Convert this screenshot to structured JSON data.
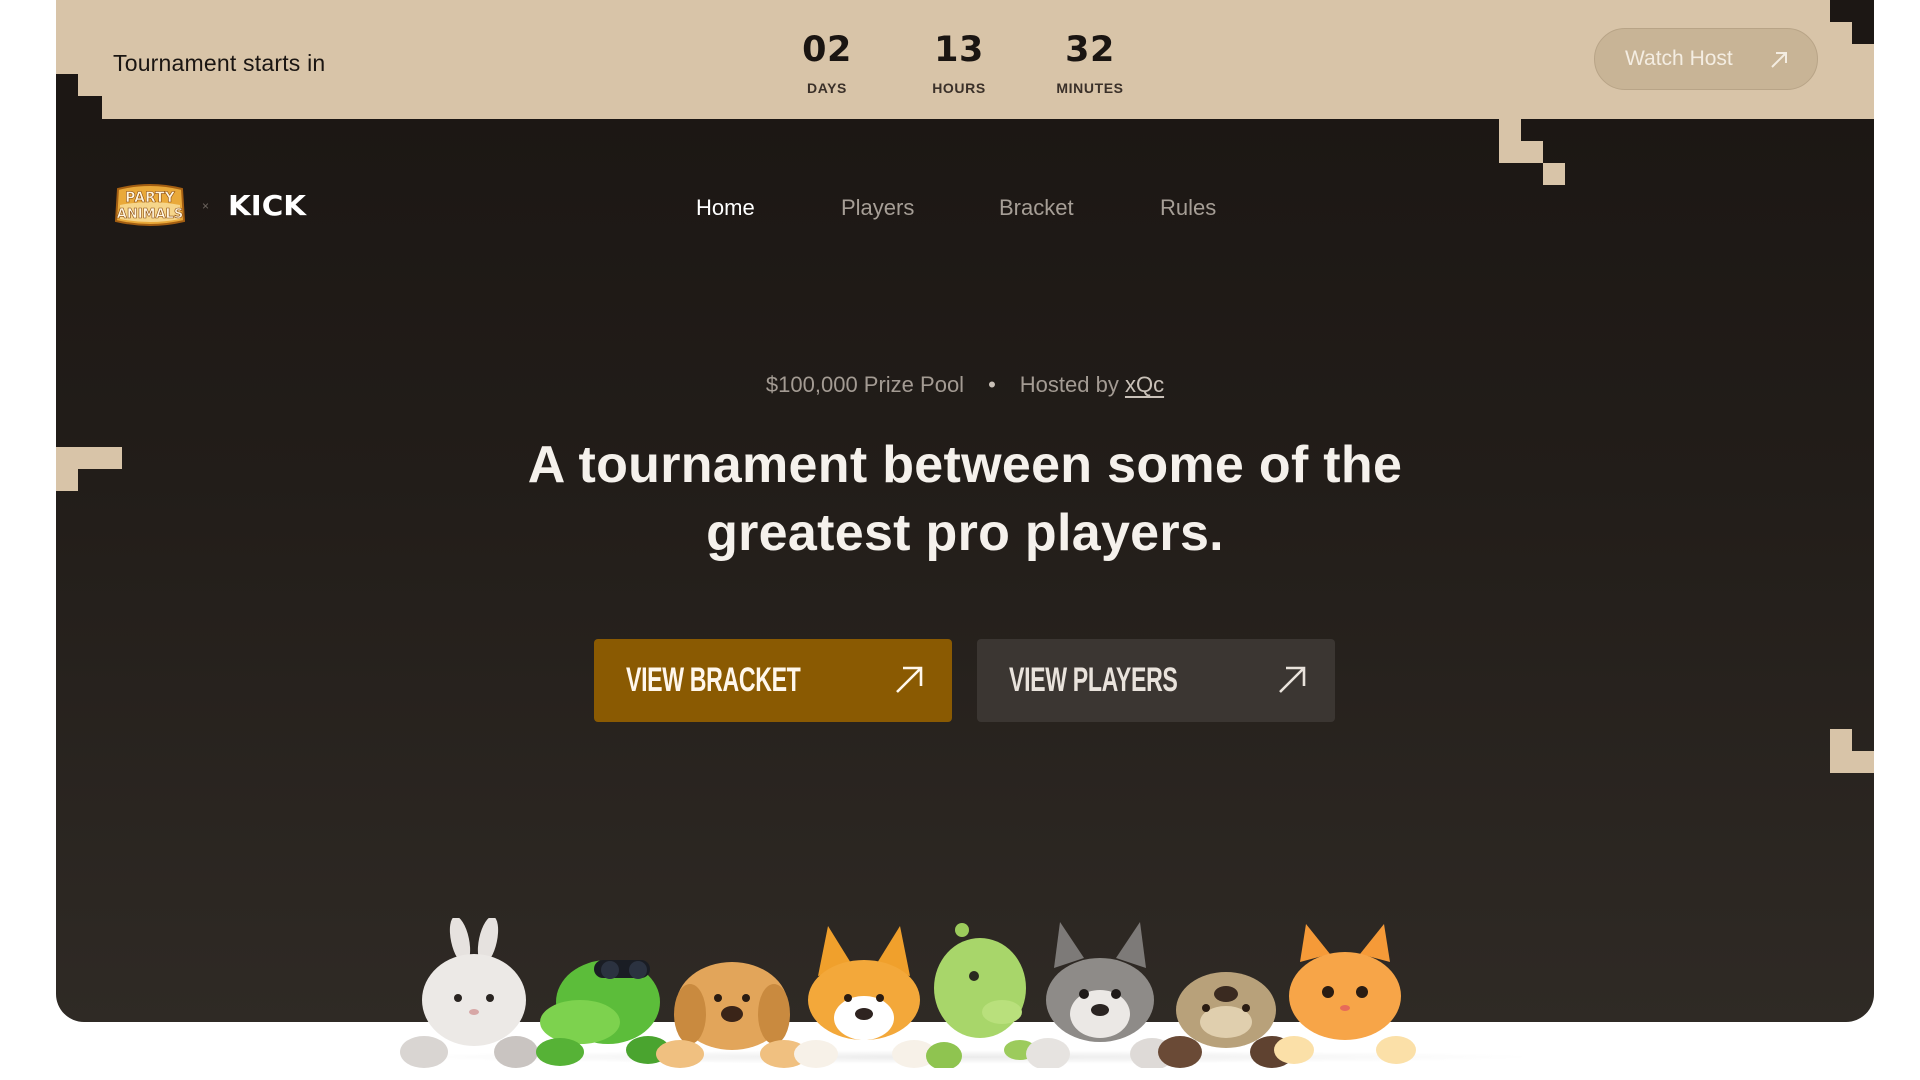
{
  "banner": {
    "label": "Tournament starts in",
    "countdown": [
      {
        "value": "02",
        "unit": "DAYS"
      },
      {
        "value": "13",
        "unit": "HOURS"
      },
      {
        "value": "32",
        "unit": "MINUTES"
      }
    ],
    "watch_label": "Watch Host"
  },
  "brand": {
    "party_line1": "PARTY",
    "party_line2": "ANIMALS",
    "separator": "×",
    "partner": "KICK"
  },
  "nav": {
    "items": [
      {
        "label": "Home",
        "active": true
      },
      {
        "label": "Players",
        "active": false
      },
      {
        "label": "Bracket",
        "active": false
      },
      {
        "label": "Rules",
        "active": false
      }
    ]
  },
  "hero": {
    "prize": "$100,000 Prize Pool",
    "dot": "•",
    "hosted_by": "Hosted by",
    "host": "xQc",
    "headline_line1": "A tournament between some of the",
    "headline_line2": "greatest pro players.",
    "primary_cta": "VIEW BRACKET",
    "secondary_cta": "VIEW PLAYERS"
  },
  "characters": [
    "bunny",
    "crocodile",
    "golden-dog",
    "corgi",
    "dinosaur",
    "husky",
    "otter",
    "orange-cat"
  ],
  "colors": {
    "banner": "#d8c4a8",
    "card_top": "#1c1714",
    "card_bottom": "#2f2a25",
    "accent": "#8a5a02",
    "secondary_button": "#3b3632"
  }
}
